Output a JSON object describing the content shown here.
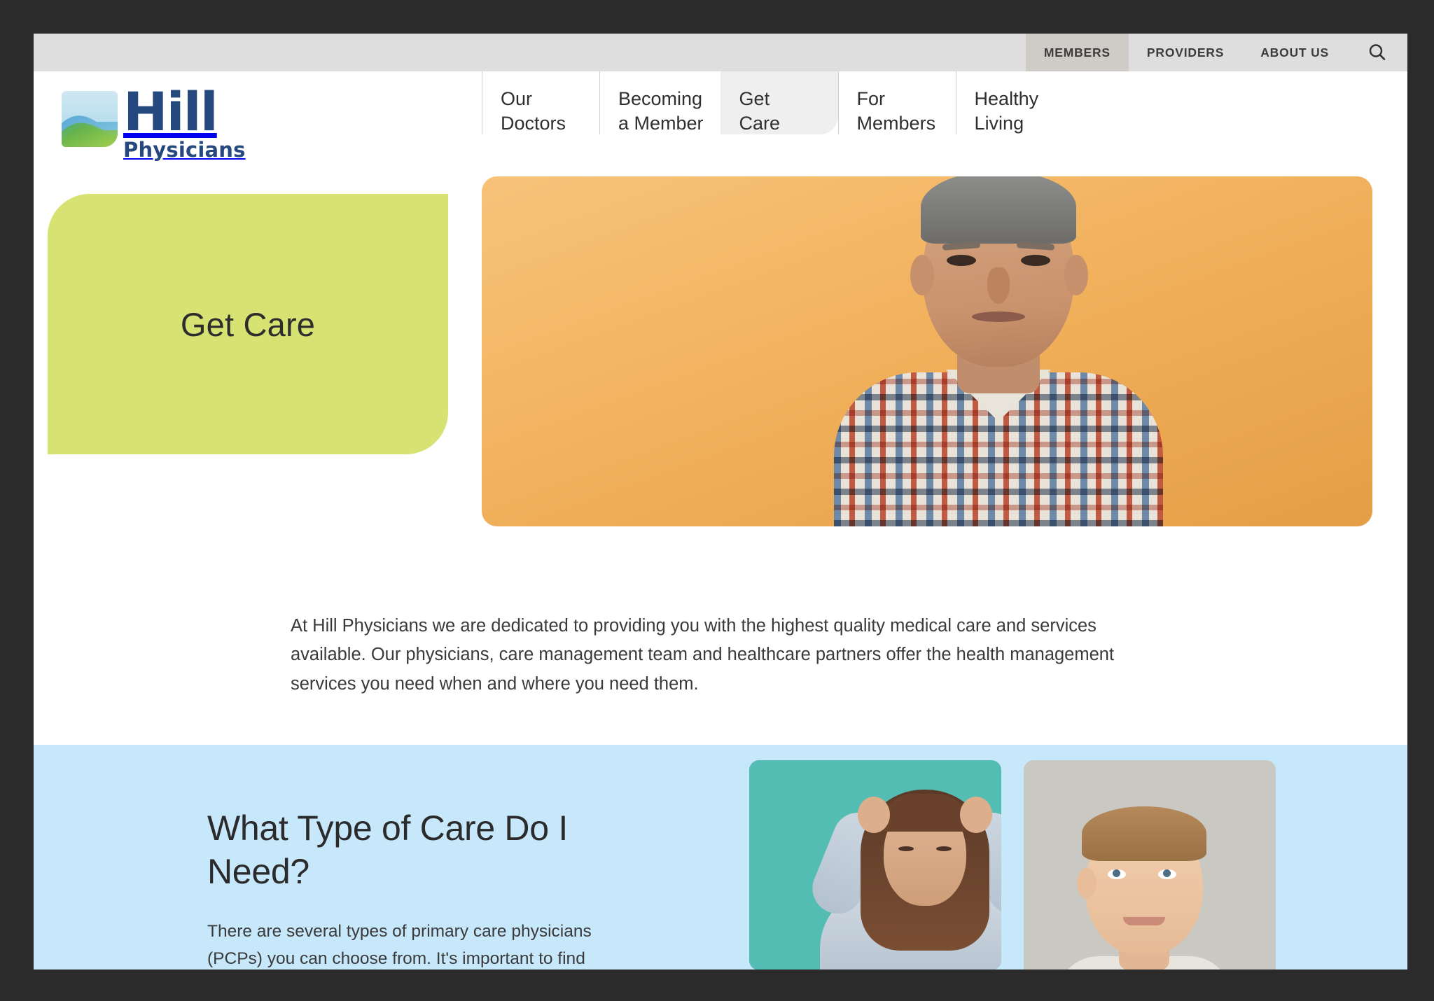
{
  "utility_nav": {
    "items": [
      {
        "label": "MEMBERS",
        "active": true
      },
      {
        "label": "PROVIDERS",
        "active": false
      },
      {
        "label": "ABOUT US",
        "active": false
      }
    ],
    "search_icon": "search-icon"
  },
  "brand": {
    "name": "Hill",
    "subtitle": "Physicians",
    "mark": "hill-logo-mark",
    "primary_color": "#25497f"
  },
  "main_nav": {
    "items": [
      {
        "line1": "Our",
        "line2": "Doctors",
        "active": false
      },
      {
        "line1": "Becoming",
        "line2": "a Member",
        "active": false
      },
      {
        "line1": "Get",
        "line2": "Care",
        "active": true
      },
      {
        "line1": "For",
        "line2": "Members",
        "active": false
      },
      {
        "line1": "Healthy",
        "line2": "Living",
        "active": false
      }
    ]
  },
  "hero": {
    "title": "Get Care",
    "green_color": "#d6e373",
    "orange_color": "#f0ae58",
    "image_alt": "senior-man-plaid-shirt-photo"
  },
  "intro": {
    "paragraph": "At Hill Physicians we are dedicated to providing you with the highest quality medical care and services available. Our physicians, care management team and healthcare partners offer the health management services you need when and where you need them."
  },
  "care_section": {
    "background_color": "#c7e7fb",
    "title": "What Type of Care Do I Need?",
    "body": "There are several types of primary care physicians (PCPs) you can choose from. It's important to find",
    "cards": [
      {
        "alt": "woman-with-headache-photo",
        "bg": "#53bdb4"
      },
      {
        "alt": "young-boy-portrait-photo",
        "bg": "#c9c8c2"
      }
    ]
  }
}
